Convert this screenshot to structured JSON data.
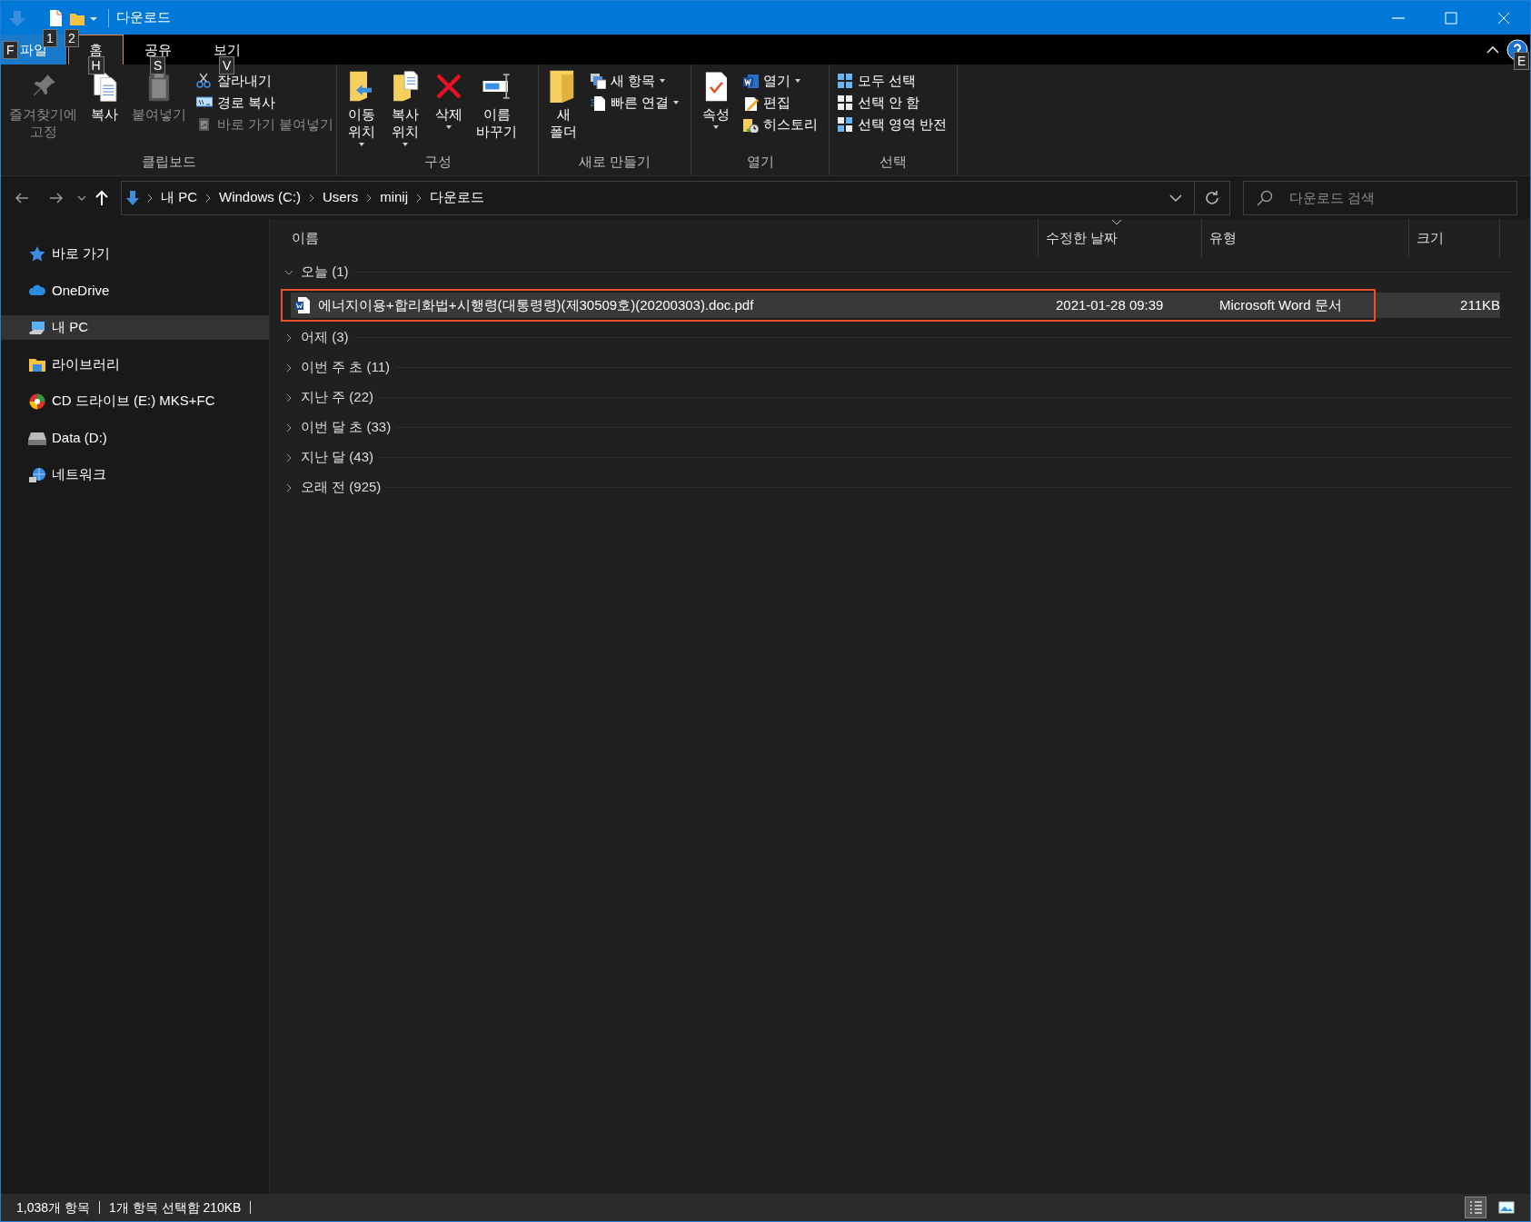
{
  "window": {
    "title": "다운로드"
  },
  "quick_access_toolbar": {
    "items": [
      {
        "key_tip": "1"
      },
      {
        "key_tip": "2"
      }
    ]
  },
  "ribbon": {
    "tabs": [
      {
        "label": "파일",
        "kind": "file",
        "key_tip": "F",
        "selected": false
      },
      {
        "label": "홈",
        "kind": "tab",
        "key_tip": "H",
        "selected": true
      },
      {
        "label": "공유",
        "kind": "tab",
        "key_tip": "S",
        "selected": false
      },
      {
        "label": "보기",
        "kind": "tab",
        "key_tip": "V",
        "selected": false
      }
    ],
    "help_key_tip": "E",
    "groups": [
      {
        "label": "클립보드",
        "items": [
          {
            "kind": "large",
            "label": "즐겨찾기에\n고정",
            "disabled": true,
            "dropdown": false
          },
          {
            "kind": "large",
            "label": "복사",
            "disabled": false,
            "dropdown": false
          },
          {
            "kind": "large",
            "label": "붙여넣기",
            "disabled": true,
            "dropdown": false
          },
          {
            "kind": "small",
            "label": "잘라내기",
            "disabled": false,
            "dropdown": false
          },
          {
            "kind": "small",
            "label": "경로 복사",
            "disabled": false,
            "dropdown": false
          },
          {
            "kind": "small",
            "label": "바로 가기 붙여넣기",
            "disabled": true,
            "dropdown": false
          }
        ]
      },
      {
        "label": "구성",
        "items": [
          {
            "kind": "large",
            "label": "이동\n위치",
            "disabled": false,
            "dropdown": true
          },
          {
            "kind": "large",
            "label": "복사\n위치",
            "disabled": false,
            "dropdown": true
          },
          {
            "kind": "large",
            "label": "삭제",
            "disabled": false,
            "dropdown": true
          },
          {
            "kind": "large",
            "label": "이름\n바꾸기",
            "disabled": false,
            "dropdown": false
          }
        ]
      },
      {
        "label": "새로 만들기",
        "items": [
          {
            "kind": "large",
            "label": "새\n폴더",
            "disabled": false,
            "dropdown": false
          },
          {
            "kind": "small",
            "label": "새 항목",
            "disabled": false,
            "dropdown": true
          },
          {
            "kind": "small",
            "label": "빠른 연결",
            "disabled": false,
            "dropdown": true
          }
        ]
      },
      {
        "label": "열기",
        "items": [
          {
            "kind": "large",
            "label": "속성",
            "disabled": false,
            "dropdown": true
          },
          {
            "kind": "small",
            "label": "열기",
            "disabled": false,
            "dropdown": true
          },
          {
            "kind": "small",
            "label": "편집",
            "disabled": false,
            "dropdown": false
          },
          {
            "kind": "small",
            "label": "히스토리",
            "disabled": false,
            "dropdown": false
          }
        ]
      },
      {
        "label": "선택",
        "items": [
          {
            "kind": "small",
            "label": "모두 선택",
            "disabled": false,
            "dropdown": false
          },
          {
            "kind": "small",
            "label": "선택 안 함",
            "disabled": false,
            "dropdown": false
          },
          {
            "kind": "small",
            "label": "선택 영역 반전",
            "disabled": false,
            "dropdown": false
          }
        ]
      }
    ]
  },
  "address_bar": {
    "path": [
      "내 PC",
      "Windows (C:)",
      "Users",
      "minij",
      "다운로드"
    ]
  },
  "search": {
    "placeholder": "다운로드 검색"
  },
  "sidebar": {
    "items": [
      {
        "label": "바로 가기",
        "selected": false
      },
      {
        "label": "OneDrive",
        "selected": false
      },
      {
        "label": "내 PC",
        "selected": true
      },
      {
        "label": "라이브러리",
        "selected": false
      },
      {
        "label": "CD 드라이브 (E:) MKS+FC",
        "selected": false
      },
      {
        "label": "Data (D:)",
        "selected": false
      },
      {
        "label": "네트워크",
        "selected": false
      }
    ]
  },
  "table": {
    "columns": [
      {
        "label": "이름",
        "sorted": false
      },
      {
        "label": "수정한 날짜",
        "sorted": true
      },
      {
        "label": "유형",
        "sorted": false
      },
      {
        "label": "크기",
        "sorted": false
      }
    ],
    "groups": [
      {
        "label": "오늘 (1)",
        "expanded": true,
        "rows": [
          {
            "name": "에너지이용+합리화법+시행령(대통령령)(제30509호)(20200303).doc.pdf",
            "modified": "2021-01-28 09:39",
            "type": "Microsoft Word 문서",
            "size": "211KB",
            "selected": true,
            "highlighted": true
          }
        ]
      },
      {
        "label": "어제 (3)",
        "expanded": false
      },
      {
        "label": "이번 주 초 (11)",
        "expanded": false
      },
      {
        "label": "지난 주 (22)",
        "expanded": false
      },
      {
        "label": "이번 달 초 (33)",
        "expanded": false
      },
      {
        "label": "지난 달 (43)",
        "expanded": false
      },
      {
        "label": "오래 전 (925)",
        "expanded": false
      }
    ]
  },
  "status_bar": {
    "items": [
      "1,038개 항목",
      "1개 항목 선택함 210KB"
    ],
    "views": [
      {
        "selected": true
      },
      {
        "selected": false
      }
    ]
  }
}
